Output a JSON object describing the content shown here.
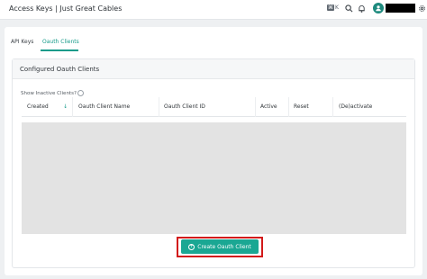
{
  "app": {
    "title": "Access Keys | Just Great Cables"
  },
  "topbar": {
    "shortcut_key": "⌘",
    "shortcut_letter": "K",
    "icons": [
      "search-icon",
      "bell-icon",
      "avatar-icon",
      "gear-icon"
    ]
  },
  "tabs": [
    {
      "label": "API Keys",
      "active": false
    },
    {
      "label": "Oauth Clients",
      "active": true
    }
  ],
  "panel": {
    "title": "Configured Oauth Clients",
    "show_inactive_label": "Show Inactive Clients?",
    "show_inactive_checked": false
  },
  "table": {
    "columns": [
      "Created",
      "Oauth Client Name",
      "Oauth Client ID",
      "Active",
      "Reset",
      "(De)activate"
    ],
    "sort_column": "Created",
    "sort_direction": "descending",
    "rows": []
  },
  "actions": {
    "create_label": "Create Oauth Client"
  },
  "colors": {
    "accent": "#1aa793",
    "highlight": "#d21a1a"
  }
}
